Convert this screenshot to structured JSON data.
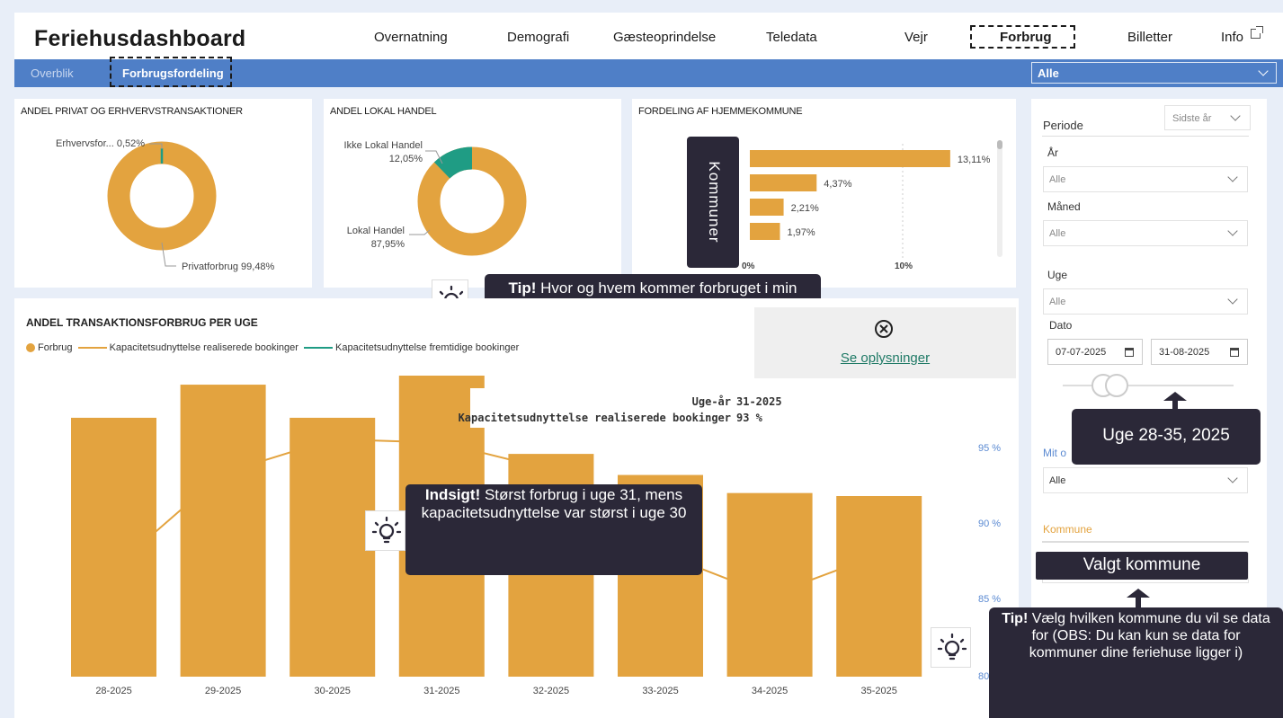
{
  "app": {
    "title": "Feriehusdashboard"
  },
  "nav": {
    "items": [
      "Overnatning",
      "Demografi",
      "Gæsteoprindelse",
      "Teledata",
      "Vejr",
      "Forbrug",
      "Billetter",
      "Info"
    ],
    "active": "Forbrug"
  },
  "subnav": {
    "tabs": [
      "Overblik",
      "Forbrugsfordeling"
    ],
    "active": "Forbrugsfordeling",
    "select_value": "Alle"
  },
  "donut1": {
    "title": "ANDEL PRIVAT OG ERHVERVSTRANSAKTIONER",
    "label_small": "Erhvervsfor... 0,52%",
    "label_large": "Privatforbrug 99,48%",
    "slices": [
      {
        "name": "Privatforbrug",
        "value": 99.48,
        "color": "#e3a33f"
      },
      {
        "name": "Erhvervsforbrug",
        "value": 0.52,
        "color": "#1f9c84"
      }
    ]
  },
  "donut2": {
    "title": "ANDEL LOKAL HANDEL",
    "label_small_1": "Ikke Lokal Handel",
    "label_small_2": "12,05%",
    "label_large_1": "Lokal Handel",
    "label_large_2": "87,95%",
    "slices": [
      {
        "name": "Lokal Handel",
        "value": 87.95,
        "color": "#e3a33f"
      },
      {
        "name": "Ikke Lokal Handel",
        "value": 12.05,
        "color": "#1f9c84"
      }
    ]
  },
  "hjemkommune": {
    "title": "FORDELING AF HJEMMEKOMMUNE",
    "overlay_label": "Kommuner",
    "axis_labels": [
      "0%",
      "10%"
    ],
    "bars": [
      {
        "value": 13.11,
        "label": "13,11%"
      },
      {
        "value": 4.37,
        "label": "4,37%"
      },
      {
        "value": 2.21,
        "label": "2,21%"
      },
      {
        "value": 1.97,
        "label": "1,97%"
      }
    ]
  },
  "tip1": {
    "bold": "Tip!",
    "text": " Hvor og hvem kommer forbruget i min kommune fra?*"
  },
  "weekly": {
    "title": "ANDEL TRANSAKTIONSFORBRUG PER UGE",
    "legend": [
      "Forbrug",
      "Kapacitetsudnyttelse realiserede bookinger",
      "Kapacitetsudnyttelse fremtidige bookinger"
    ],
    "tooltip": {
      "row1_key": "Uge-år",
      "row1_val": "31-2025",
      "row2_key": "Kapacitetsudnyttelse realiserede bookinger",
      "row2_val": "93 %"
    },
    "right_axis": [
      "95 %",
      "90 %",
      "85 %",
      "80"
    ]
  },
  "chart_data": {
    "type": "bar",
    "categories": [
      "28-2025",
      "29-2025",
      "30-2025",
      "31-2025",
      "32-2025",
      "33-2025",
      "34-2025",
      "35-2025"
    ],
    "series": [
      {
        "name": "Forbrug",
        "type": "bar",
        "values": [
          0.86,
          0.97,
          0.86,
          1.0,
          0.74,
          0.67,
          0.61,
          0.6
        ]
      },
      {
        "name": "Kapacitetsudnyttelse realiserede bookinger",
        "type": "line",
        "axis": "right",
        "values": [
          85.6,
          91.2,
          93.2,
          93.0,
          91.4,
          86.5,
          84.0,
          86.4
        ]
      }
    ],
    "y2lim": [
      79.2,
      97.8
    ],
    "title": "ANDEL TRANSAKTIONSFORBRUG PER UGE"
  },
  "info_panel": {
    "link": "Se oplysninger"
  },
  "insight": {
    "bold": "Indsigt!",
    "text": " Størst forbrug i uge 31, mens kapacitetsudnyttelse var størst i uge 30"
  },
  "slicers": {
    "periode_label": "Periode",
    "periode_value": "Sidste år",
    "aar_label": "År",
    "aar_value": "Alle",
    "maaned_label": "Måned",
    "maaned_value": "Alle",
    "uge_label": "Uge",
    "uge_value": "Alle",
    "dato_label": "Dato",
    "dato_from": "07-07-2025",
    "dato_to": "31-08-2025",
    "mit_label": "Mit o",
    "mit_value": "Alle",
    "kommune_label": "Kommune"
  },
  "callouts": {
    "uge": "Uge 28-35, 2025",
    "valgt": "Valgt kommune",
    "tip2_bold": "Tip!",
    "tip2_text": " Vælg hvilken kommune du vil se data for (OBS: Du kan kun se data for kommuner dine feriehuse ligger i)"
  },
  "colors": {
    "accent": "#4f7fc7",
    "bar": "#e3a33f",
    "teal": "#1f9c84",
    "callout": "#2b2838"
  }
}
